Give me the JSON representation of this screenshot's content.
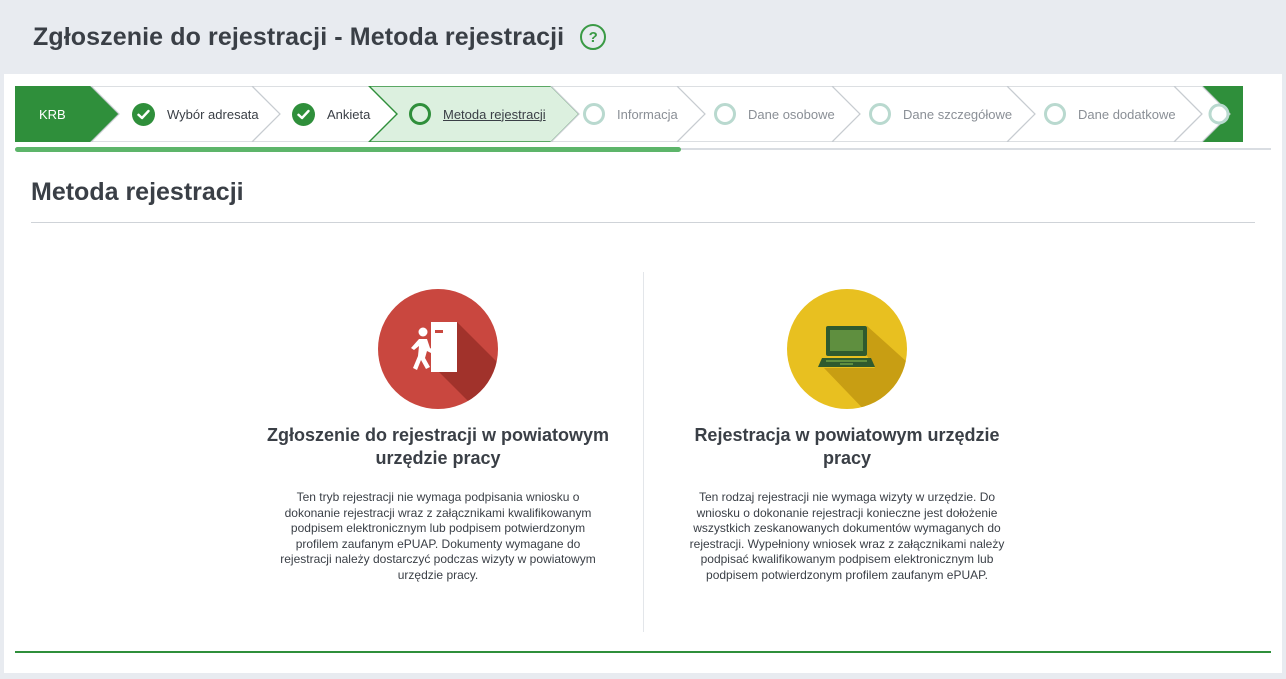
{
  "header": {
    "title": "Zgłoszenie do rejestracji - Metoda rejestracji",
    "help_symbol": "?"
  },
  "stepper": {
    "prefix": "KRB",
    "steps": [
      {
        "label": "Wybór adresata",
        "state": "done"
      },
      {
        "label": "Ankieta",
        "state": "done"
      },
      {
        "label": "Metoda rejestracji",
        "state": "active"
      },
      {
        "label": "Informacja",
        "state": "todo"
      },
      {
        "label": "Dane osobowe",
        "state": "todo"
      },
      {
        "label": "Dane szczegółowe",
        "state": "todo"
      },
      {
        "label": "Dane dodatkowe",
        "state": "todo"
      }
    ],
    "progress_fraction": 0.53
  },
  "section": {
    "title": "Metoda rejestracji"
  },
  "options": [
    {
      "title": "Zgłoszenie do rejestracji w powiatowym urzędzie pracy",
      "description": "Ten tryb rejestracji nie wymaga podpisania wniosku o dokonanie rejestracji wraz z załącznikami kwalifikowanym podpisem elektronicznym lub podpisem potwierdzonym profilem zaufanym ePUAP. Dokumenty wymagane do rejestracji należy dostarczyć podczas wizyty w powiatowym urzędzie pracy.",
      "icon": "person-door-icon",
      "color": "#c9473f"
    },
    {
      "title": "Rejestracja w powiatowym urzędzie pracy",
      "description": "Ten rodzaj rejestracji nie wymaga wizyty w urzędzie. Do wniosku o dokonanie rejestracji konieczne jest dołożenie wszystkich zeskanowanych dokumentów wymaganych do rejestracji. Wypełniony wniosek wraz z załącznikami należy podpisać kwalifikowanym podpisem elektronicznym lub podpisem potwierdzonym profilem zaufanym ePUAP.",
      "icon": "laptop-icon",
      "color": "#e8c020"
    }
  ],
  "colors": {
    "accent_green": "#2f8f3b",
    "active_step_bg": "#dcf0df",
    "progress_green": "#5db56a"
  }
}
